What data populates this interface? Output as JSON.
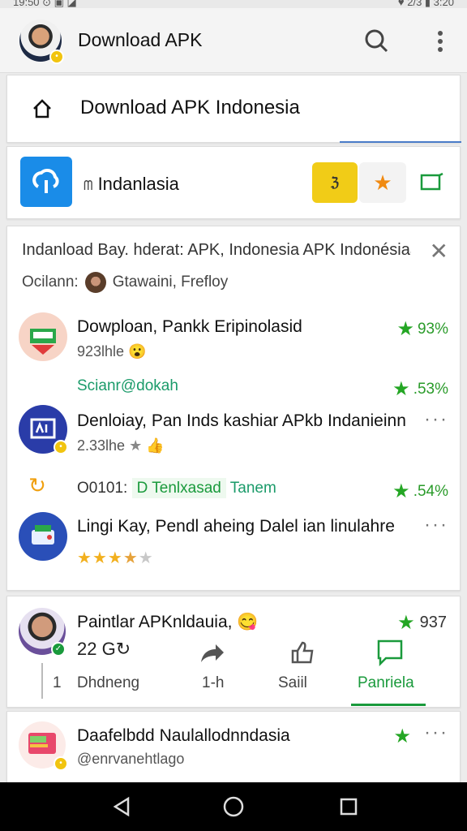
{
  "status_bar": {
    "left": "19:50 ⊙ ▣ ◪",
    "right": "♥ 2/3 ▮ 3:20"
  },
  "app_bar": {
    "title": "Download APK"
  },
  "home_card": {
    "title": "Download APK Indonesia"
  },
  "app_card": {
    "prefix": "ᗰ",
    "name": "Indanlasia",
    "yellow_btn": "ℨ"
  },
  "feed": {
    "header": "Indanload Bay. hderat: APK, Indonesia APK Indonésiaa.",
    "sub_left": "Ocilann:",
    "sub_right": "Gtawaini, Frefloy",
    "items": [
      {
        "title": "Dowploan, Pankk Eripinolasid",
        "meta": "923lhle",
        "stat": "93%"
      },
      {
        "link": "Scianr@dokah",
        "stat": ".53%"
      },
      {
        "title": "Denloiay, Pan Inds kashiar APkb Indanieinn",
        "meta": "2.33lhe",
        "more": "···"
      },
      {
        "pre": "O0101:",
        "chip": "D Tenlxasad",
        "post": "Tanem",
        "stat": ".54%"
      },
      {
        "title": "Lingi Kay, Pendl aheing Dalel ian linulahre",
        "more": "···",
        "rating": 3.5
      }
    ]
  },
  "post": {
    "title": "Paintlar APKnldauia,",
    "stat": "937",
    "actions": [
      {
        "label": "Dhdneng",
        "count": "1",
        "icon": "vertical-line-icon"
      },
      {
        "label": "1-h",
        "icon": "share-arrow-icon"
      },
      {
        "label": "Saiil",
        "icon": "like-icon"
      },
      {
        "label": "Panriela",
        "icon": "comment-icon",
        "active": true
      }
    ],
    "like_count": "22"
  },
  "bottom_post": {
    "title": "Daafelbdd Naulallodnndasia",
    "handle": "@enrvanehtlago",
    "more": "···"
  },
  "colors": {
    "accent": "#1a9a3c",
    "brand_blue": "#1a8ce8",
    "yellow": "#f1cc17",
    "orange": "#f08a12"
  }
}
